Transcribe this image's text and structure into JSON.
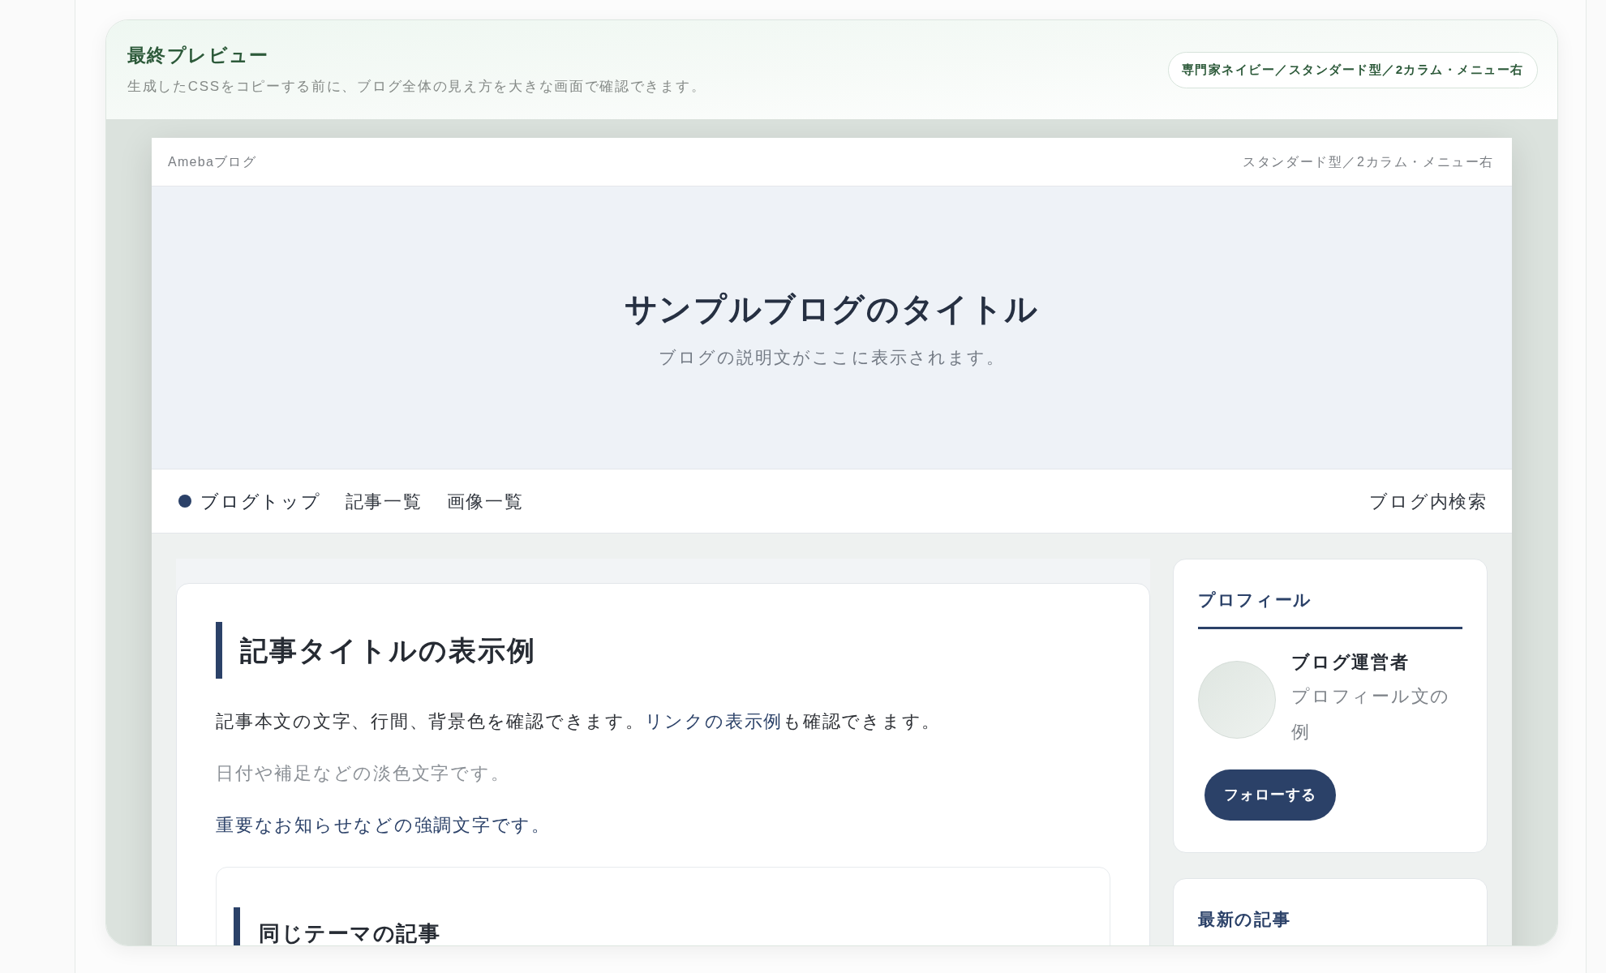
{
  "preview_panel": {
    "title": "最終プレビュー",
    "description": "生成したCSSをコピーする前に、ブログ全体の見え方を大きな画面で確認できます。",
    "badge": "専門家ネイビー／スタンダード型／2カラム・メニュー右"
  },
  "blog_preview": {
    "top_bar": {
      "service": "Amebaブログ",
      "layout": "スタンダード型／2カラム・メニュー右"
    },
    "header": {
      "title": "サンプルブログのタイトル",
      "description": "ブログの説明文がここに表示されます。"
    },
    "nav": {
      "items": [
        {
          "label": "ブログトップ",
          "selected": true
        },
        {
          "label": "記事一覧",
          "selected": false
        },
        {
          "label": "画像一覧",
          "selected": false
        }
      ],
      "search": "ブログ内検索"
    },
    "article": {
      "title": "記事タイトルの表示例",
      "paragraphs": [
        {
          "kind": "body",
          "parts": [
            {
              "kind": "text",
              "text": "記事本文の文字、行間、背景色を確認できます。"
            },
            {
              "kind": "link",
              "text": "リンクの表示例"
            },
            {
              "kind": "text",
              "text": "も確認できます。"
            }
          ]
        },
        {
          "kind": "muted",
          "parts": [
            {
              "kind": "text",
              "text": "日付や補足などの淡色文字です。"
            }
          ]
        },
        {
          "kind": "emphasis",
          "parts": [
            {
              "kind": "text",
              "text": "重要なお知らせなどの強調文字です。"
            }
          ]
        }
      ],
      "related": {
        "title": "同じテーマの記事"
      }
    },
    "sidebar": {
      "widgets": [
        {
          "kind": "profile",
          "title": "プロフィール",
          "name": "ブログ運営者",
          "bio": "プロフィール文の例",
          "button": "フォローする"
        },
        {
          "kind": "recent",
          "title": "最新の記事"
        }
      ]
    }
  }
}
